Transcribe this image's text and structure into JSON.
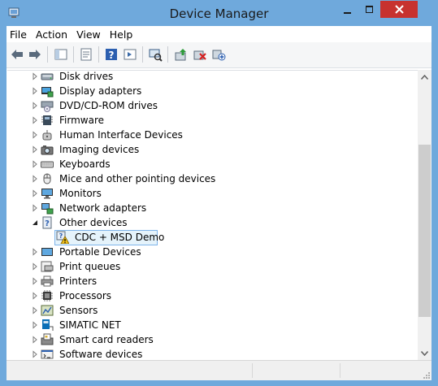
{
  "window": {
    "title": "Device Manager"
  },
  "menu": [
    "File",
    "Action",
    "View",
    "Help"
  ],
  "toolbar": [
    "back-icon",
    "forward-icon",
    "show-hide-console-tree-icon",
    "properties-icon",
    "help-icon",
    "action-pane-icon",
    "scan-hardware-changes-icon",
    "update-driver-icon",
    "uninstall-device-icon",
    "add-legacy-hardware-icon"
  ],
  "tree": {
    "items": [
      {
        "label": "Disk drives",
        "icon": "disk-drive-icon",
        "expanded": false
      },
      {
        "label": "Display adapters",
        "icon": "display-adapter-icon",
        "expanded": false
      },
      {
        "label": "DVD/CD-ROM drives",
        "icon": "dvd-drive-icon",
        "expanded": false
      },
      {
        "label": "Firmware",
        "icon": "firmware-icon",
        "expanded": false
      },
      {
        "label": "Human Interface Devices",
        "icon": "hid-icon",
        "expanded": false
      },
      {
        "label": "Imaging devices",
        "icon": "camera-icon",
        "expanded": false
      },
      {
        "label": "Keyboards",
        "icon": "keyboard-icon",
        "expanded": false
      },
      {
        "label": "Mice and other pointing devices",
        "icon": "mouse-icon",
        "expanded": false
      },
      {
        "label": "Monitors",
        "icon": "monitor-icon",
        "expanded": false
      },
      {
        "label": "Network adapters",
        "icon": "network-adapter-icon",
        "expanded": false
      },
      {
        "label": "Other devices",
        "icon": "unknown-device-icon",
        "expanded": true
      },
      {
        "label": "CDC + MSD Demo",
        "icon": "warning-device-icon",
        "child": true,
        "selected": true
      },
      {
        "label": "Portable Devices",
        "icon": "portable-device-icon",
        "expanded": false
      },
      {
        "label": "Print queues",
        "icon": "print-queue-icon",
        "expanded": false
      },
      {
        "label": "Printers",
        "icon": "printer-icon",
        "expanded": false
      },
      {
        "label": "Processors",
        "icon": "processor-icon",
        "expanded": false
      },
      {
        "label": "Sensors",
        "icon": "sensor-icon",
        "expanded": false
      },
      {
        "label": "SIMATIC NET",
        "icon": "simatic-net-icon",
        "expanded": false
      },
      {
        "label": "Smart card readers",
        "icon": "smart-card-reader-icon",
        "expanded": false
      },
      {
        "label": "Software devices",
        "icon": "software-device-icon",
        "expanded": false
      }
    ]
  },
  "colors": {
    "chrome": "#6fa9dc",
    "close": "#c7322f",
    "selection_bg": "#e5f3fb",
    "selection_border": "#7eb4ea"
  }
}
